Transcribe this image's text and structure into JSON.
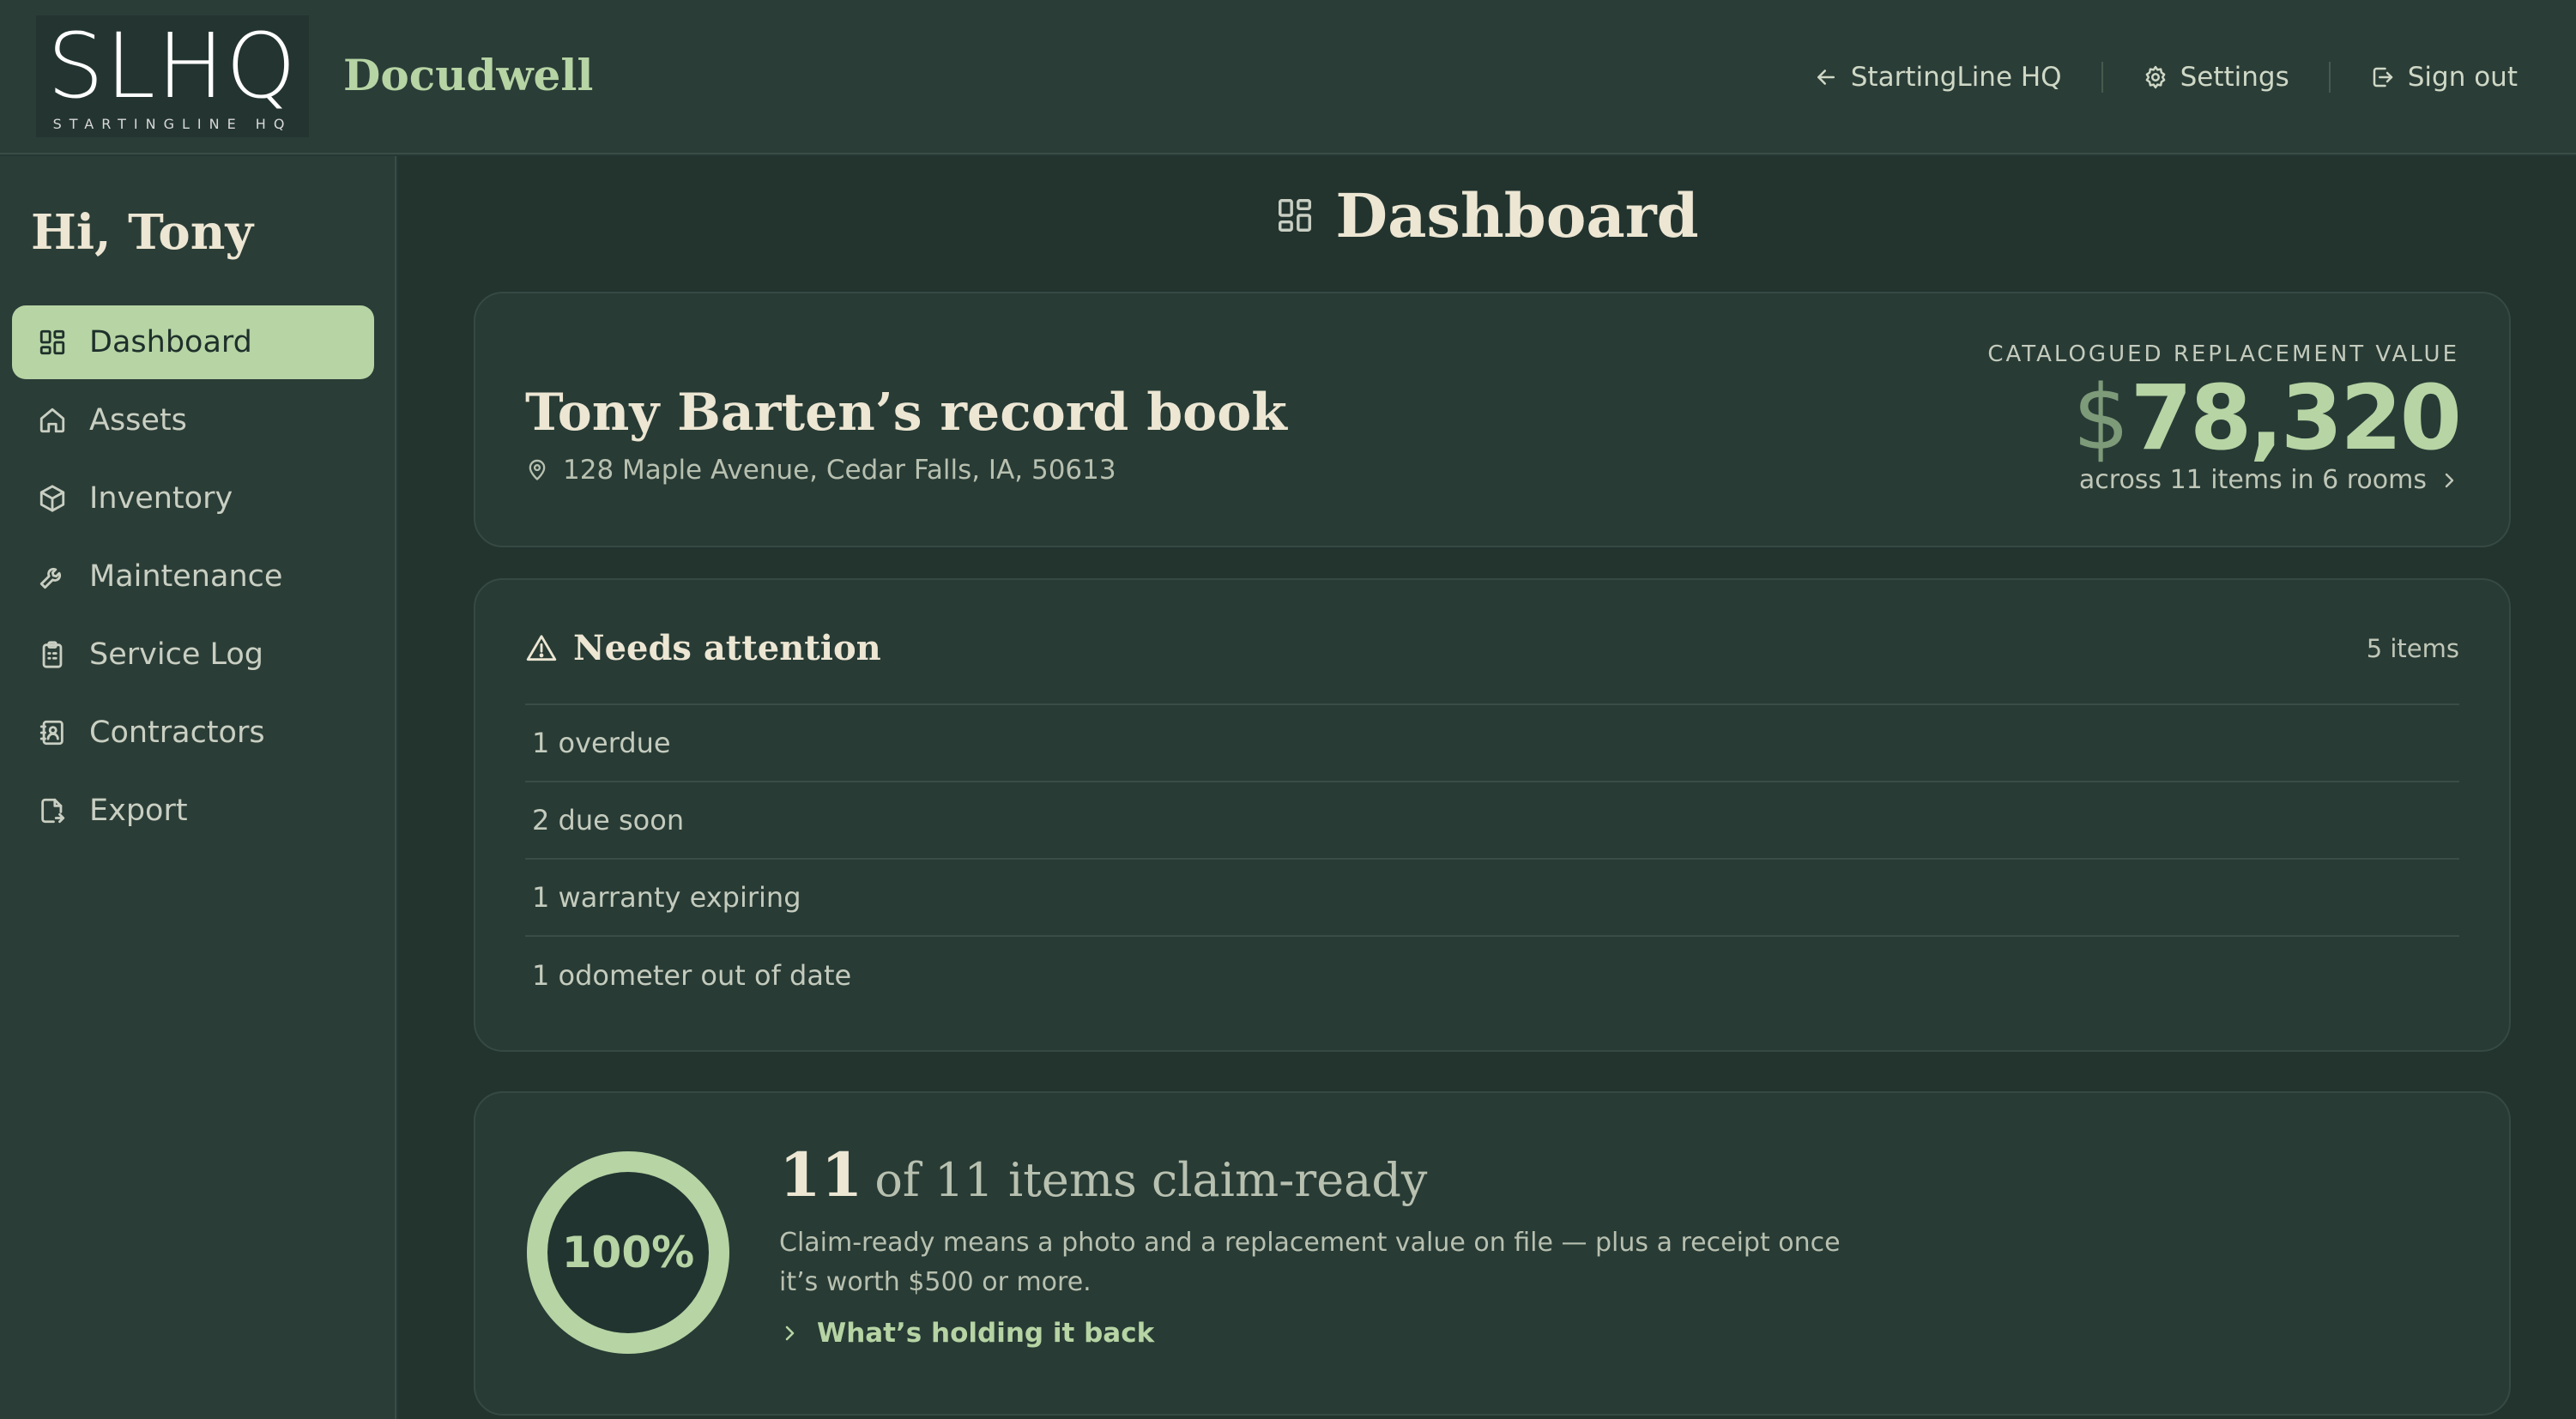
{
  "brand": {
    "logo_text": "SLHQ",
    "logo_subtitle": "STARTINGLINE HQ",
    "app_name": "Docudwell"
  },
  "topnav": {
    "back_label": "StartingLine HQ",
    "settings_label": "Settings",
    "signout_label": "Sign out"
  },
  "sidebar": {
    "greeting": "Hi, Tony",
    "items": [
      {
        "label": "Dashboard",
        "icon": "dashboard-icon",
        "active": true
      },
      {
        "label": "Assets",
        "icon": "home-icon"
      },
      {
        "label": "Inventory",
        "icon": "box-icon"
      },
      {
        "label": "Maintenance",
        "icon": "wrench-icon"
      },
      {
        "label": "Service Log",
        "icon": "clipboard-icon"
      },
      {
        "label": "Contractors",
        "icon": "contact-book-icon"
      },
      {
        "label": "Export",
        "icon": "file-export-icon"
      }
    ]
  },
  "main": {
    "title": "Dashboard",
    "record": {
      "title": "Tony Barten’s record book",
      "address": "128 Maple Avenue, Cedar Falls, IA, 50613",
      "value_label": "CATALOGUED REPLACEMENT VALUE",
      "currency": "$",
      "value": "78,320",
      "summary": "across 11 items in 6 rooms"
    },
    "attention": {
      "title": "Needs attention",
      "count": "5 items",
      "rows": [
        "1 overdue",
        "2 due soon",
        "1 warranty expiring",
        "1 odometer out of date"
      ]
    },
    "claim": {
      "percent_label": "100%",
      "percent": 100,
      "ready_count": "11",
      "heading_rest": "of 11 items claim-ready",
      "description": "Claim-ready means a photo and a replacement value on file — plus a receipt once it’s worth $500 or more.",
      "link_label": "What’s holding it back"
    }
  },
  "colors": {
    "accent": "#b6d4a4",
    "background": "#253833",
    "panel": "#2b3d37"
  }
}
